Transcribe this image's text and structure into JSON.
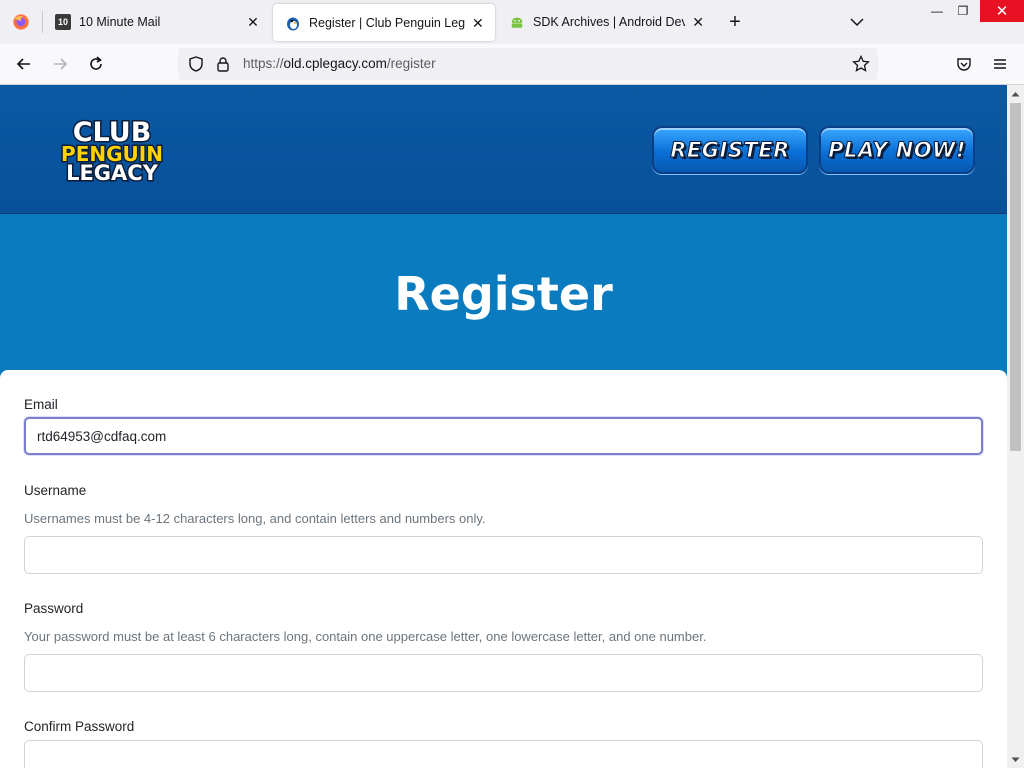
{
  "browser": {
    "tabs": [
      {
        "label": "10 Minute Mail",
        "favicon_text": "10",
        "active": false
      },
      {
        "label": "Register | Club Penguin Legacy",
        "active": true
      },
      {
        "label": "SDK Archives | Android Develop",
        "active": false
      }
    ],
    "new_tab_symbol": "+",
    "window_controls": {
      "minimize": "—",
      "maximize": "❐",
      "close": "✕"
    },
    "url": {
      "scheme": "https://",
      "host": "old.cplegacy.com",
      "path": "/register"
    }
  },
  "header": {
    "logo": {
      "line1": "CLUB",
      "line2": "PENGUIN",
      "line3": "LEGACY"
    },
    "register_button": "REGISTER",
    "play_button": "PLAY NOW!"
  },
  "hero": {
    "title": "Register"
  },
  "form": {
    "email": {
      "label": "Email",
      "value": "rtd64953@cdfaq.com"
    },
    "username": {
      "label": "Username",
      "help": "Usernames must be 4-12 characters long, and contain letters and numbers only.",
      "value": ""
    },
    "password": {
      "label": "Password",
      "help": "Your password must be at least 6 characters long, contain one uppercase letter, one lowercase letter, and one number.",
      "value": ""
    },
    "confirm_password": {
      "label": "Confirm Password",
      "value": ""
    }
  },
  "colors": {
    "header_bg": "#0a5aa3",
    "hero_bg": "#0b7bbf",
    "focus_border": "#7a7ecf",
    "close_red": "#e81123"
  },
  "icons": [
    "firefox-icon",
    "close-icon",
    "plus-icon",
    "chevron-down-icon",
    "back-arrow-icon",
    "forward-arrow-icon",
    "reload-icon",
    "shield-icon",
    "lock-icon",
    "star-icon",
    "pocket-icon",
    "menu-icon"
  ]
}
